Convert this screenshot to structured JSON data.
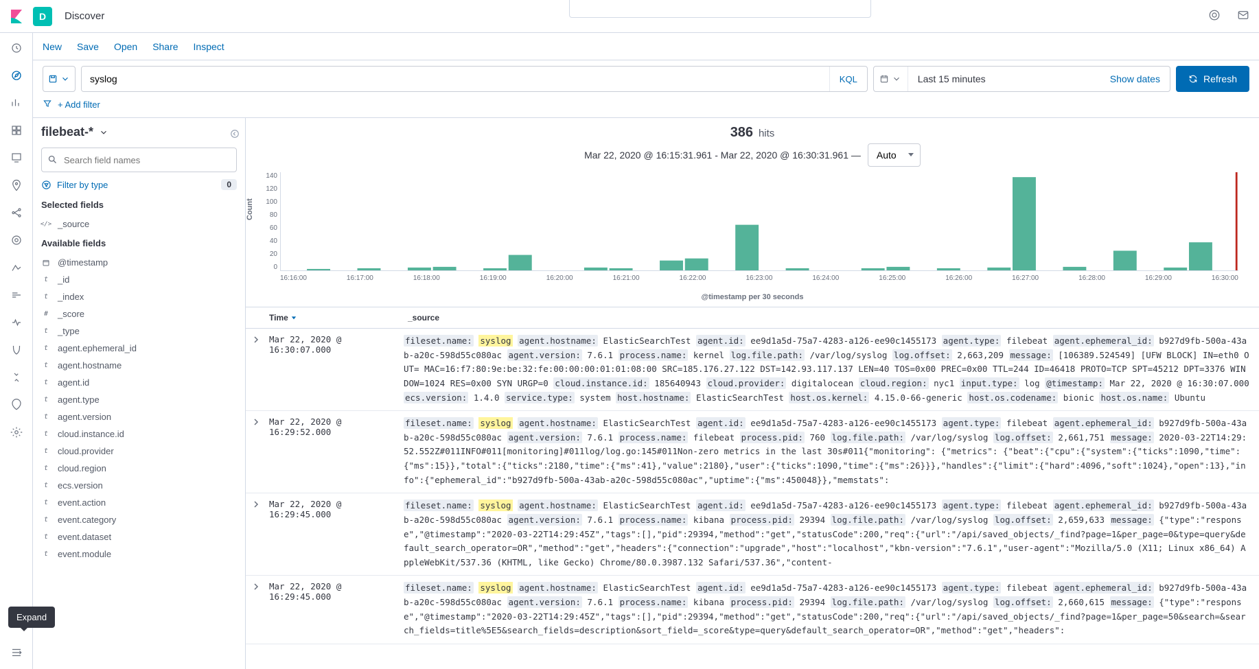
{
  "header": {
    "badge": "D",
    "breadcrumb": "Discover"
  },
  "toolbar": {
    "new": "New",
    "save": "Save",
    "open": "Open",
    "share": "Share",
    "inspect": "Inspect"
  },
  "query": {
    "value": "syslog",
    "kql": "KQL",
    "date": "Last 15 minutes",
    "show_dates": "Show dates",
    "refresh": "Refresh",
    "add_filter": "+ Add filter"
  },
  "sidebar": {
    "index_pattern": "filebeat-*",
    "search_placeholder": "Search field names",
    "filter_by_type": "Filter by type",
    "filter_count": "0",
    "selected_title": "Selected fields",
    "available_title": "Available fields",
    "selected": [
      {
        "icon": "</>",
        "name": "_source"
      }
    ],
    "available": [
      {
        "icon": "cal",
        "name": "@timestamp"
      },
      {
        "icon": "t",
        "name": "_id"
      },
      {
        "icon": "t",
        "name": "_index"
      },
      {
        "icon": "#",
        "name": "_score"
      },
      {
        "icon": "t",
        "name": "_type"
      },
      {
        "icon": "t",
        "name": "agent.ephemeral_id"
      },
      {
        "icon": "t",
        "name": "agent.hostname"
      },
      {
        "icon": "t",
        "name": "agent.id"
      },
      {
        "icon": "t",
        "name": "agent.type"
      },
      {
        "icon": "t",
        "name": "agent.version"
      },
      {
        "icon": "t",
        "name": "cloud.instance.id"
      },
      {
        "icon": "t",
        "name": "cloud.provider"
      },
      {
        "icon": "t",
        "name": "cloud.region"
      },
      {
        "icon": "t",
        "name": "ecs.version"
      },
      {
        "icon": "t",
        "name": "event.action"
      },
      {
        "icon": "t",
        "name": "event.category"
      },
      {
        "icon": "t",
        "name": "event.dataset"
      },
      {
        "icon": "t",
        "name": "event.module"
      }
    ]
  },
  "hits": {
    "count": "386",
    "label": "hits",
    "range": "Mar 22, 2020 @ 16:15:31.961 - Mar 22, 2020 @ 16:30:31.961 —",
    "interval": "Auto"
  },
  "chart_data": {
    "type": "bar",
    "ylabel": "Count",
    "xlabel": "@timestamp per 30 seconds",
    "ylim": [
      0,
      140
    ],
    "yticks": [
      "140",
      "120",
      "100",
      "80",
      "60",
      "40",
      "20",
      "0"
    ],
    "xticks": [
      "16:16:00",
      "16:17:00",
      "16:18:00",
      "16:19:00",
      "16:20:00",
      "16:21:00",
      "16:22:00",
      "16:23:00",
      "16:24:00",
      "16:25:00",
      "16:26:00",
      "16:27:00",
      "16:28:00",
      "16:29:00",
      "16:30:00"
    ],
    "values": [
      0,
      2,
      0,
      3,
      0,
      4,
      5,
      0,
      3,
      22,
      0,
      0,
      4,
      3,
      0,
      14,
      17,
      0,
      65,
      0,
      3,
      0,
      0,
      3,
      5,
      0,
      3,
      0,
      4,
      133,
      0,
      5,
      0,
      28,
      0,
      4,
      40,
      0
    ]
  },
  "table": {
    "time_col": "Time",
    "source_col": "_source",
    "rows": [
      {
        "time": "Mar 22, 2020 @ 16:30:07.000",
        "pairs": [
          [
            "fileset.name:",
            "syslog",
            true
          ],
          [
            "agent.hostname:",
            "ElasticSearchTest"
          ],
          [
            "agent.id:",
            "ee9d1a5d-75a7-4283-a126-ee90c1455173"
          ],
          [
            "agent.type:",
            "filebeat"
          ],
          [
            "agent.ephemeral_id:",
            "b927d9fb-500a-43ab-a20c-598d55c080ac"
          ],
          [
            "agent.version:",
            "7.6.1"
          ],
          [
            "process.name:",
            "kernel"
          ],
          [
            "log.file.path:",
            "/var/log/syslog"
          ],
          [
            "log.offset:",
            "2,663,209"
          ],
          [
            "message:",
            "[106389.524549] [UFW BLOCK] IN=eth0 OUT= MAC=16:f7:80:9e:be:32:fe:00:00:00:01:01:08:00 SRC=185.176.27.122 DST=142.93.117.137 LEN=40 TOS=0x00 PREC=0x00 TTL=244 ID=46418 PROTO=TCP SPT=45212 DPT=3376 WINDOW=1024 RES=0x00 SYN URGP=0"
          ],
          [
            "cloud.instance.id:",
            "185640943"
          ],
          [
            "cloud.provider:",
            "digitalocean"
          ],
          [
            "cloud.region:",
            "nyc1"
          ],
          [
            "input.type:",
            "log"
          ],
          [
            "@timestamp:",
            "Mar 22, 2020 @ 16:30:07.000"
          ],
          [
            "ecs.version:",
            "1.4.0"
          ],
          [
            "service.type:",
            "system"
          ],
          [
            "host.hostname:",
            "ElasticSearchTest"
          ],
          [
            "host.os.kernel:",
            "4.15.0-66-generic"
          ],
          [
            "host.os.codename:",
            "bionic"
          ],
          [
            "host.os.name:",
            "Ubuntu"
          ]
        ]
      },
      {
        "time": "Mar 22, 2020 @ 16:29:52.000",
        "pairs": [
          [
            "fileset.name:",
            "syslog",
            true
          ],
          [
            "agent.hostname:",
            "ElasticSearchTest"
          ],
          [
            "agent.id:",
            "ee9d1a5d-75a7-4283-a126-ee90c1455173"
          ],
          [
            "agent.type:",
            "filebeat"
          ],
          [
            "agent.ephemeral_id:",
            "b927d9fb-500a-43ab-a20c-598d55c080ac"
          ],
          [
            "agent.version:",
            "7.6.1"
          ],
          [
            "process.name:",
            "filebeat"
          ],
          [
            "process.pid:",
            "760"
          ],
          [
            "log.file.path:",
            "/var/log/syslog"
          ],
          [
            "log.offset:",
            "2,661,751"
          ],
          [
            "message:",
            "2020-03-22T14:29:52.552Z#011INFO#011[monitoring]#011log/log.go:145#011Non-zero metrics in the last 30s#011{\"monitoring\": {\"metrics\": {\"beat\":{\"cpu\":{\"system\":{\"ticks\":1090,\"time\":{\"ms\":15}},\"total\":{\"ticks\":2180,\"time\":{\"ms\":41},\"value\":2180},\"user\":{\"ticks\":1090,\"time\":{\"ms\":26}}},\"handles\":{\"limit\":{\"hard\":4096,\"soft\":1024},\"open\":13},\"info\":{\"ephemeral_id\":\"b927d9fb-500a-43ab-a20c-598d55c080ac\",\"uptime\":{\"ms\":450048}},\"memstats\":"
          ]
        ]
      },
      {
        "time": "Mar 22, 2020 @ 16:29:45.000",
        "pairs": [
          [
            "fileset.name:",
            "syslog",
            true
          ],
          [
            "agent.hostname:",
            "ElasticSearchTest"
          ],
          [
            "agent.id:",
            "ee9d1a5d-75a7-4283-a126-ee90c1455173"
          ],
          [
            "agent.type:",
            "filebeat"
          ],
          [
            "agent.ephemeral_id:",
            "b927d9fb-500a-43ab-a20c-598d55c080ac"
          ],
          [
            "agent.version:",
            "7.6.1"
          ],
          [
            "process.name:",
            "kibana"
          ],
          [
            "process.pid:",
            "29394"
          ],
          [
            "log.file.path:",
            "/var/log/syslog"
          ],
          [
            "log.offset:",
            "2,659,633"
          ],
          [
            "message:",
            "{\"type\":\"response\",\"@timestamp\":\"2020-03-22T14:29:45Z\",\"tags\":[],\"pid\":29394,\"method\":\"get\",\"statusCode\":200,\"req\":{\"url\":\"/api/saved_objects/_find?page=1&per_page=0&type=query&default_search_operator=OR\",\"method\":\"get\",\"headers\":{\"connection\":\"upgrade\",\"host\":\"localhost\",\"kbn-version\":\"7.6.1\",\"user-agent\":\"Mozilla/5.0 (X11; Linux x86_64) AppleWebKit/537.36 (KHTML, like Gecko) Chrome/80.0.3987.132 Safari/537.36\",\"content-"
          ]
        ]
      },
      {
        "time": "Mar 22, 2020 @ 16:29:45.000",
        "pairs": [
          [
            "fileset.name:",
            "syslog",
            true
          ],
          [
            "agent.hostname:",
            "ElasticSearchTest"
          ],
          [
            "agent.id:",
            "ee9d1a5d-75a7-4283-a126-ee90c1455173"
          ],
          [
            "agent.type:",
            "filebeat"
          ],
          [
            "agent.ephemeral_id:",
            "b927d9fb-500a-43ab-a20c-598d55c080ac"
          ],
          [
            "agent.version:",
            "7.6.1"
          ],
          [
            "process.name:",
            "kibana"
          ],
          [
            "process.pid:",
            "29394"
          ],
          [
            "log.file.path:",
            "/var/log/syslog"
          ],
          [
            "log.offset:",
            "2,660,615"
          ],
          [
            "message:",
            "{\"type\":\"response\",\"@timestamp\":\"2020-03-22T14:29:45Z\",\"tags\":[],\"pid\":29394,\"method\":\"get\",\"statusCode\":200,\"req\":{\"url\":\"/api/saved_objects/_find?page=1&per_page=50&search=&search_fields=title%5E5&search_fields=description&sort_field=_score&type=query&default_search_operator=OR\",\"method\":\"get\",\"headers\":"
          ]
        ]
      }
    ]
  },
  "tooltip": "Expand"
}
